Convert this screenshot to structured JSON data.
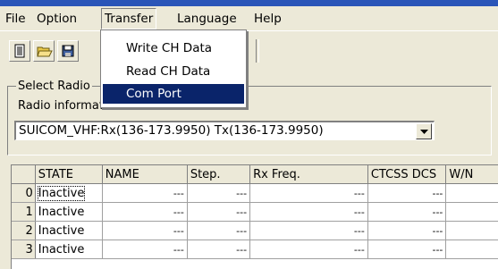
{
  "menu": {
    "file": "File",
    "option": "Option",
    "transfer": "Transfer",
    "language": "Language",
    "help": "Help"
  },
  "transfer_menu": {
    "items": [
      "Write CH Data",
      "Read CH Data",
      "Com Port"
    ],
    "highlighted": "Com Port"
  },
  "toolbar": {
    "buttons": [
      "new-document-icon",
      "open-folder-icon",
      "save-disk-icon"
    ]
  },
  "select_radio": {
    "group_title": "Select Radio",
    "field_label": "Radio information",
    "selected_value": "SUICOM_VHF:Rx(136-173.9950) Tx(136-173.9950)"
  },
  "grid": {
    "columns": [
      "STATE",
      "NAME",
      "Step.",
      "Rx Freq.",
      "CTCSS DCS",
      "W/N"
    ],
    "rows": [
      {
        "index": "0",
        "state": "Inactive",
        "name": "---",
        "step": "---",
        "rx": "---",
        "ctcss": "---"
      },
      {
        "index": "1",
        "state": "Inactive",
        "name": "---",
        "step": "---",
        "rx": "---",
        "ctcss": "---"
      },
      {
        "index": "2",
        "state": "Inactive",
        "name": "---",
        "step": "---",
        "rx": "---",
        "ctcss": "---"
      },
      {
        "index": "3",
        "state": "Inactive",
        "name": "---",
        "step": "---",
        "rx": "---",
        "ctcss": "---"
      }
    ]
  },
  "colors": {
    "selection": "#0a246a",
    "face": "#ece9d8",
    "title_strip": "#2a55b8"
  }
}
